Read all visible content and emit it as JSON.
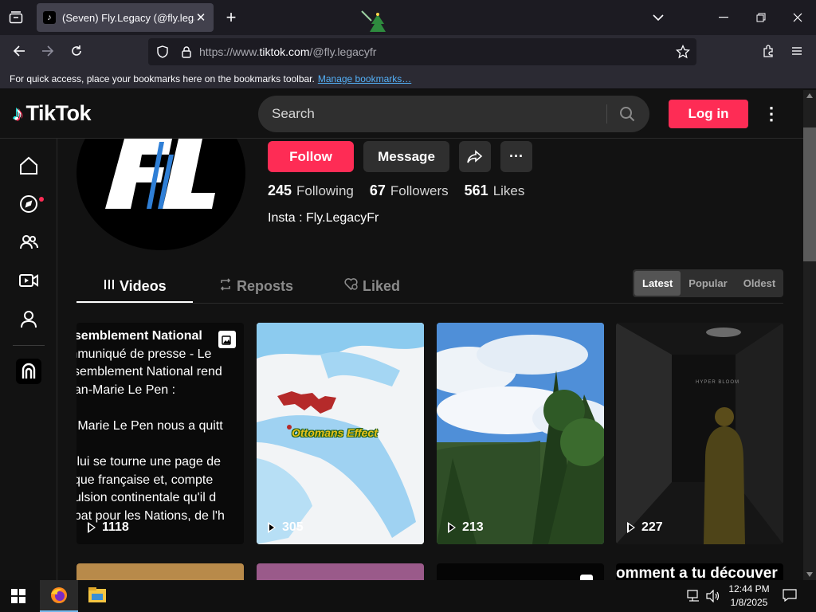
{
  "browser": {
    "tab_title": "(Seven) Fly.Legacy (@fly.legacyfr) | TikTok",
    "url_prefix": "https://www.",
    "url_host": "tiktok.com",
    "url_path": "/@fly.legacyfr",
    "bookmarks_text": "For quick access, place your bookmarks here on the bookmarks toolbar.",
    "bookmarks_link": "Manage bookmarks…"
  },
  "header": {
    "logo": "TikTok",
    "search_placeholder": "Search",
    "login": "Log in"
  },
  "profile": {
    "avatar_text": "FL",
    "follow": "Follow",
    "message": "Message",
    "following_count": "245",
    "following_label": "Following",
    "followers_count": "67",
    "followers_label": "Followers",
    "likes_count": "561",
    "likes_label": "Likes",
    "bio": "Insta : Fly.LegacyFr"
  },
  "tabs": {
    "videos": "Videos",
    "reposts": "Reposts",
    "liked": "Liked",
    "sort": [
      "Latest",
      "Popular",
      "Oldest"
    ]
  },
  "videos": [
    {
      "views": "1118",
      "lines": [
        "ssemblement National",
        "mmuniqué de presse - Le",
        "ssemblement National rend",
        "ean-Marie Le Pen :",
        "",
        "n Marie Le Pen nous a quitt",
        "",
        "c lui se tourne une page de",
        "tique française et, compte",
        "pulsion continentale qu'il d",
        "nbat pour les Nations, de l'h"
      ]
    },
    {
      "views": "305",
      "caption": "Ottomans Effect"
    },
    {
      "views": "213"
    },
    {
      "views": "227",
      "caption": "HYPER BLOOM"
    }
  ],
  "row2_caption": "omment a tu découver",
  "taskbar": {
    "time": "12:44 PM",
    "date": "1/8/2025"
  },
  "colors": {
    "brand": "#fe2c55",
    "accent_cyan": "#25f4ee",
    "bg": "#121212"
  }
}
